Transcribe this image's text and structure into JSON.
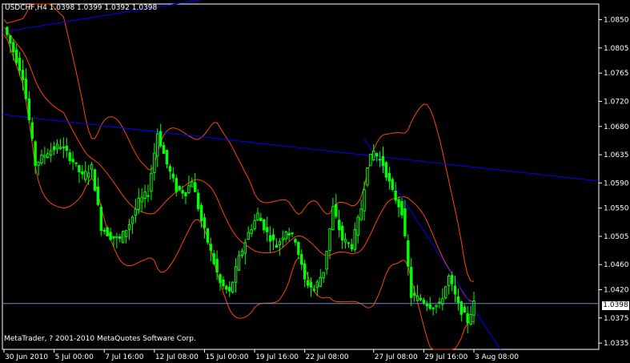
{
  "header": {
    "symbol_line": "USDCHF,H4  1.0398 1.0399 1.0392 1.0398"
  },
  "footer": {
    "copyright": "MetaTrader, ? 2001-2010 MetaQuotes Software Corp."
  },
  "current_price_label": "1.0398",
  "colors": {
    "background": "#000000",
    "candle": "#00ff00",
    "bands": "#ff4500",
    "trendline": "#0000ff",
    "price_line": "#6e8ec4",
    "frame": "#ffffff"
  },
  "chart_data": {
    "type": "candlestick",
    "ylim": [
      1.0325,
      1.0875
    ],
    "y_ticks": [
      "1.0850",
      "1.0805",
      "1.0765",
      "1.0720",
      "1.0680",
      "1.0635",
      "1.0590",
      "1.0550",
      "1.0505",
      "1.0460",
      "1.0420",
      "1.0375",
      "1.0335"
    ],
    "y_tick_values": [
      1.085,
      1.0805,
      1.0765,
      1.072,
      1.068,
      1.0635,
      1.059,
      1.055,
      1.0505,
      1.046,
      1.042,
      1.0375,
      1.0335
    ],
    "x_ticks": [
      "30 Jun 2010",
      "5 Jul 00:00",
      "7 Jul 16:00",
      "12 Jul 08:00",
      "15 Jul 00:00",
      "19 Jul 16:00",
      "22 Jul 08:00",
      "27 Jul 08:00",
      "29 Jul 16:00",
      "3 Aug 08:00"
    ],
    "x_tick_bars": [
      0,
      16,
      32,
      48,
      64,
      80,
      96,
      118,
      134,
      150
    ],
    "bar_count": 150,
    "current_price": 1.0398,
    "close_path": [
      [
        0,
        1.0838
      ],
      [
        3,
        1.08
      ],
      [
        6,
        1.076
      ],
      [
        8,
        1.069
      ],
      [
        10,
        1.062
      ],
      [
        14,
        1.064
      ],
      [
        18,
        1.065
      ],
      [
        22,
        1.0625
      ],
      [
        25,
        1.06
      ],
      [
        28,
        1.0615
      ],
      [
        31,
        1.052
      ],
      [
        34,
        1.0505
      ],
      [
        37,
        1.05
      ],
      [
        40,
        1.0525
      ],
      [
        43,
        1.056
      ],
      [
        46,
        1.0575
      ],
      [
        49,
        1.067
      ],
      [
        52,
        1.062
      ],
      [
        55,
        1.058
      ],
      [
        58,
        1.0575
      ],
      [
        60,
        1.0595
      ],
      [
        63,
        1.053
      ],
      [
        66,
        1.048
      ],
      [
        69,
        1.043
      ],
      [
        72,
        1.0415
      ],
      [
        75,
        1.047
      ],
      [
        78,
        1.051
      ],
      [
        81,
        1.054
      ],
      [
        84,
        1.051
      ],
      [
        87,
        1.049
      ],
      [
        90,
        1.0515
      ],
      [
        93,
        1.05
      ],
      [
        96,
        1.0435
      ],
      [
        99,
        1.042
      ],
      [
        102,
        1.045
      ],
      [
        105,
        1.055
      ],
      [
        108,
        1.05
      ],
      [
        111,
        1.049
      ],
      [
        114,
        1.055
      ],
      [
        116,
        1.062
      ],
      [
        118,
        1.064
      ],
      [
        121,
        1.062
      ],
      [
        124,
        1.0575
      ],
      [
        127,
        1.0545
      ],
      [
        130,
        1.041
      ],
      [
        133,
        1.0405
      ],
      [
        136,
        1.0395
      ],
      [
        139,
        1.0395
      ],
      [
        142,
        1.044
      ],
      [
        145,
        1.0395
      ],
      [
        148,
        1.037
      ],
      [
        150,
        1.0398
      ]
    ]
  }
}
